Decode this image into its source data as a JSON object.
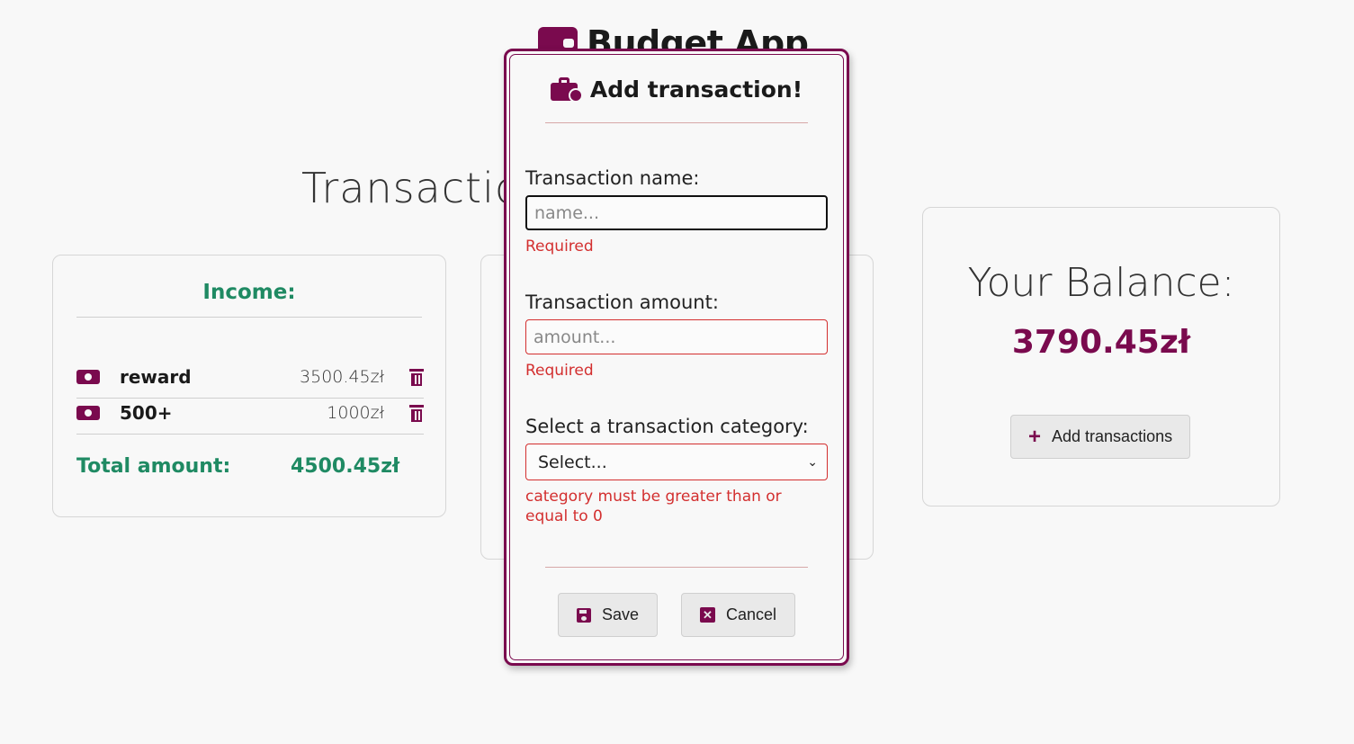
{
  "app": {
    "title": "Budget App"
  },
  "page": {
    "section_title": "Transactio"
  },
  "income": {
    "heading": "Income:",
    "items": [
      {
        "name": "reward",
        "amount": "3500.45zł"
      },
      {
        "name": "500+",
        "amount": "1000zł"
      }
    ],
    "total_label": "Total amount:",
    "total_value": "4500.45zł"
  },
  "balance": {
    "heading": "Your Balance:",
    "value": "3790.45zł",
    "add_button_label": "Add transactions"
  },
  "modal": {
    "title": "Add transaction!",
    "name_field": {
      "label": "Transaction name:",
      "placeholder": "name...",
      "error": "Required"
    },
    "amount_field": {
      "label": "Transaction amount:",
      "placeholder": "amount...",
      "error": "Required"
    },
    "category_field": {
      "label": "Select a transaction category:",
      "selected": "Select...",
      "error": "category must be greater than or equal to 0"
    },
    "save_label": "Save",
    "cancel_label": "Cancel"
  },
  "colors": {
    "accent": "#7a0a4e",
    "income_green": "#1f8a63",
    "error_red": "#d32f2f",
    "background": "#f8f8f8"
  }
}
